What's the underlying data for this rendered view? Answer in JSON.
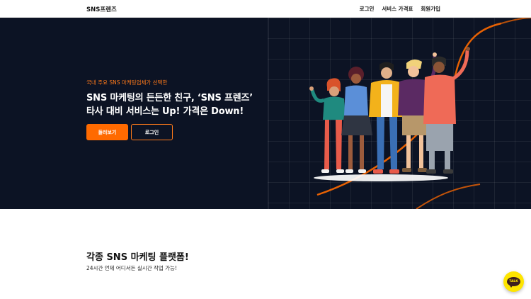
{
  "header": {
    "logo": "SNS프렌즈",
    "nav": [
      "로그인",
      "서비스 가격표",
      "회원가입"
    ]
  },
  "hero": {
    "eyebrow": "국내 주요 SNS 마케팅업체가 선택한",
    "headline_line1": "SNS 마케팅의 든든한 친구, ‘SNS 프렌즈’",
    "headline_line2": "타사 대비 서비스는 Up! 가격은 Down!",
    "primary_button": "둘러보기",
    "secondary_button": "로그인",
    "illustration": "group-of-friends-illustration"
  },
  "section": {
    "title": "각종 SNS 마케팅 플랫폼!",
    "subtitle": "24시간 언제 어디서든 실시간 작업 가능!"
  },
  "floating": {
    "talk_label": "TALK",
    "icon": "kakao-talk-icon"
  },
  "colors": {
    "accent": "#ff6a00",
    "hero_bg": "#0c1324",
    "talk_yellow": "#fee500"
  }
}
